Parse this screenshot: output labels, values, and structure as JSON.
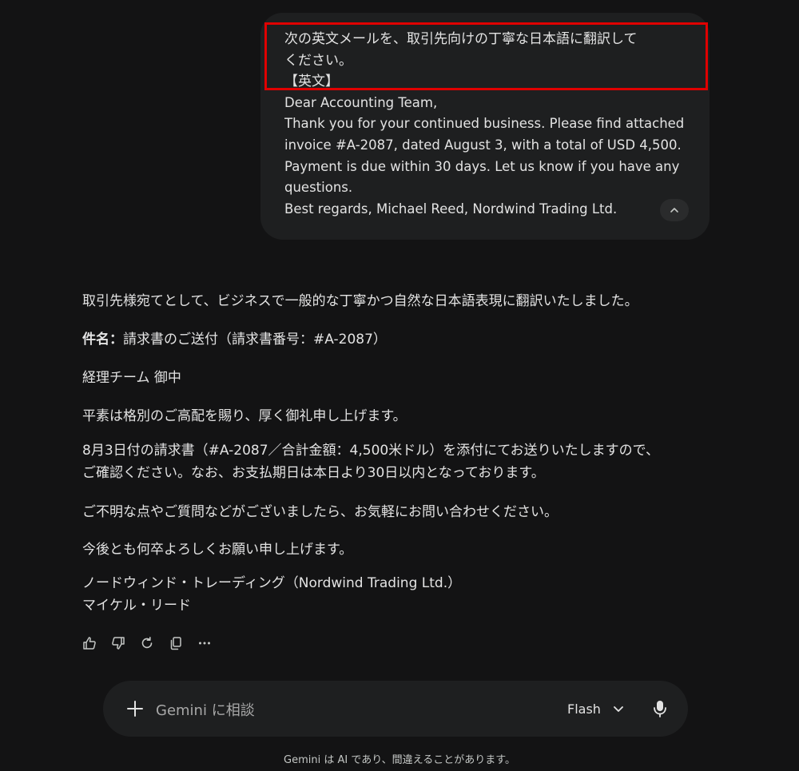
{
  "user_message": {
    "lines": [
      "次の英文メールを、取引先向けの丁寧な日本語に翻訳して",
      "ください。",
      "【英文】",
      "Dear Accounting Team,",
      "Thank you for your continued business. Please find attached",
      "invoice #A-2087, dated August 3, with a total of USD 4,500.",
      "Payment is due within 30 days. Let us know if you have any",
      "questions.",
      "Best regards, Michael Reed, Nordwind Trading Ltd."
    ]
  },
  "response": {
    "intro": "取引先様宛てとして、ビジネスで一般的な丁寧かつ自然な日本語表現に翻訳いたしました。",
    "subject_label": "件名：",
    "subject_value": "請求書のご送付（請求書番号：#A-2087）",
    "addressee": "経理チーム 御中",
    "greeting": "平素は格別のご高配を賜り、厚く御礼申し上げます。",
    "body1_line1": "8月3日付の請求書（#A-2087／合計金額：4,500米ドル）を添付にてお送りいたしますので、",
    "body1_line2": "ご確認ください。なお、お支払期日は本日より30日以内となっております。",
    "body2": "ご不明な点やご質問などがございましたら、お気軽にお問い合わせください。",
    "closing": "今後とも何卒よろしくお願い申し上げます。",
    "signature_line1": "ノードウィンド・トレーディング（Nordwind Trading Ltd.）",
    "signature_line2": "マイケル・リード"
  },
  "actions": {
    "icons": [
      "thumb-up-icon",
      "thumb-down-icon",
      "regenerate-icon",
      "copy-icon",
      "more-icon"
    ]
  },
  "input": {
    "placeholder": "Gemini に相談",
    "model": "Flash"
  },
  "disclaimer": "Gemini は AI であり、間違えることがあります。",
  "colors": {
    "background": "#131314",
    "bubble": "#1e1f20",
    "highlight": "#e00000",
    "text": "#e3e3e3"
  }
}
